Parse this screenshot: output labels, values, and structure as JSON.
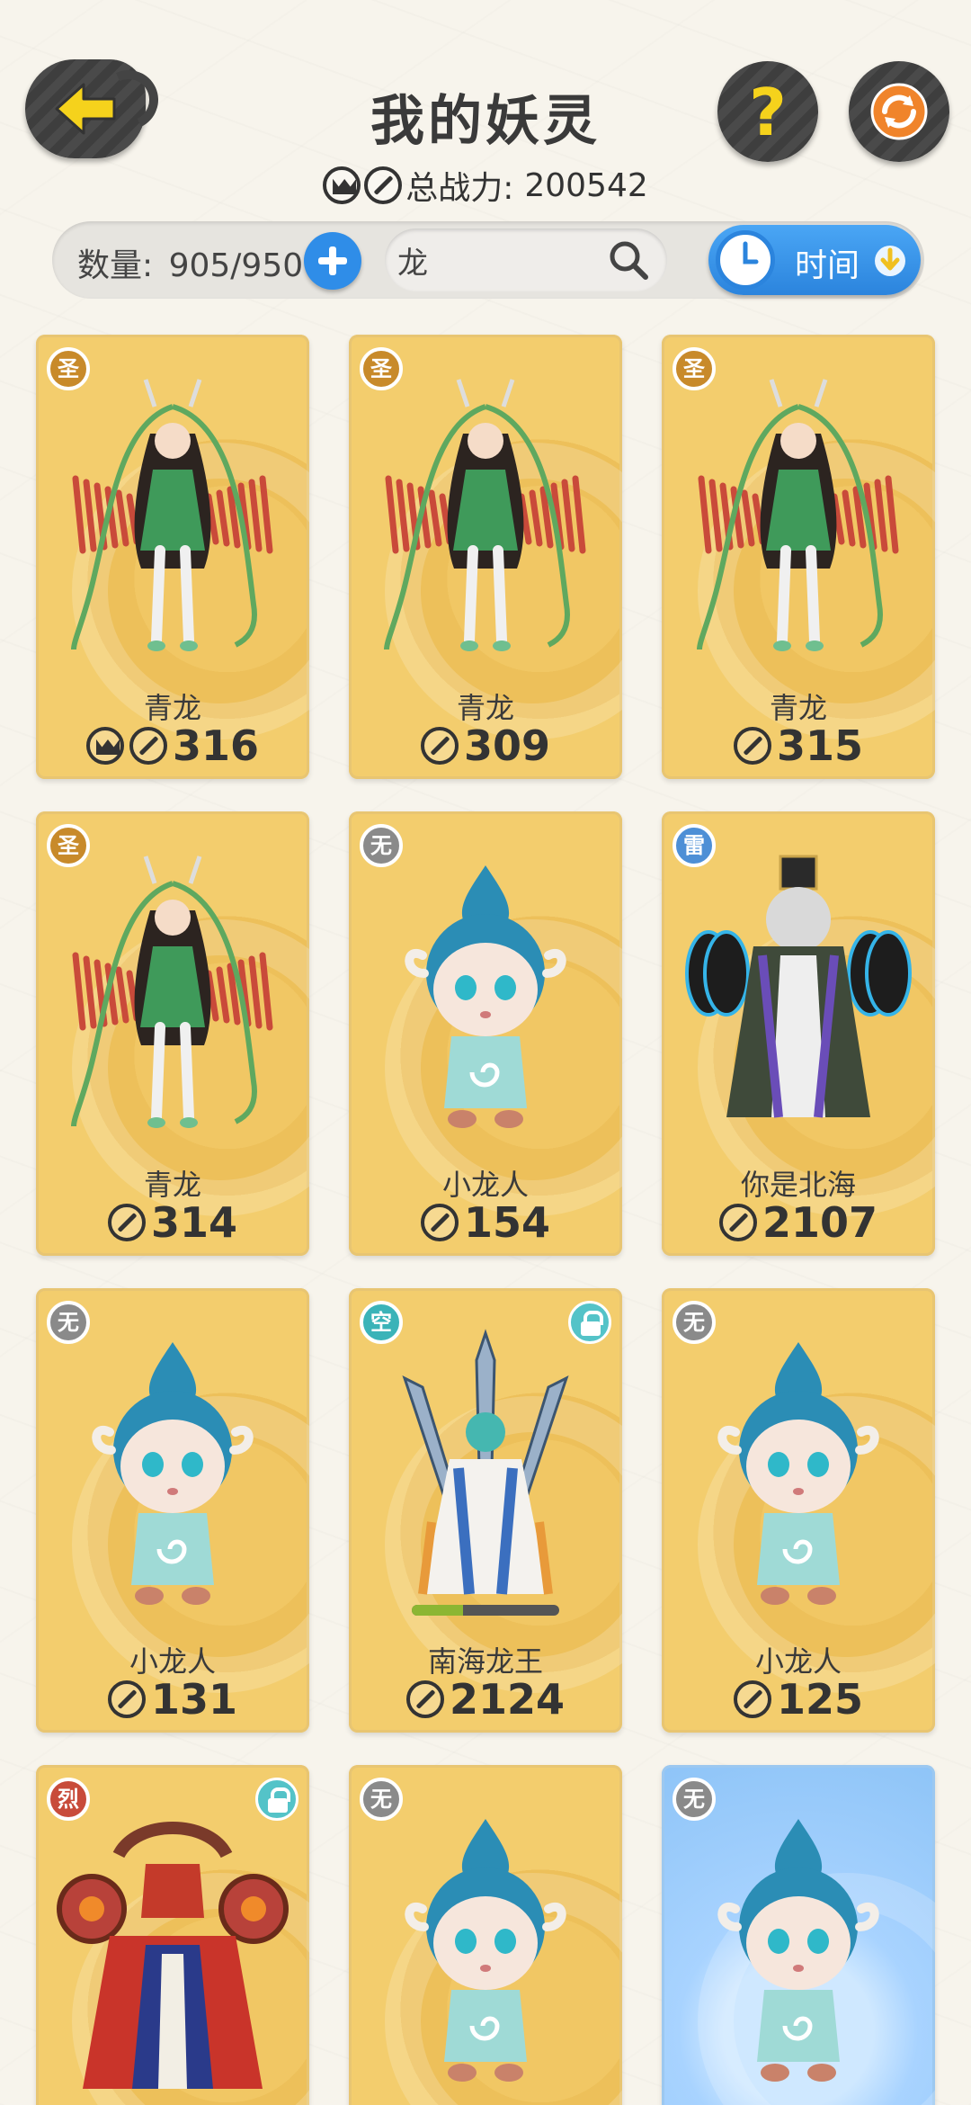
{
  "header": {
    "title": "我的妖灵",
    "power_label": "总战力:",
    "power_value": "200542"
  },
  "toolbar": {
    "count_label": "数量:",
    "count_value": "905/950",
    "search_value": "龙",
    "sort_label": "时间"
  },
  "colors": {
    "card_gold": "#f3cd6d",
    "accent_blue": "#2f8de8",
    "badge_saint": "#c88a2a",
    "badge_none": "#8a8a8a",
    "badge_thunder": "#4d8fd6",
    "badge_void": "#3bb3b8",
    "badge_fire": "#c84b3a"
  },
  "cards": [
    {
      "element": "圣",
      "name": "青龙",
      "power": "316",
      "crown": true,
      "locked": false,
      "figure": "qinglong"
    },
    {
      "element": "圣",
      "name": "青龙",
      "power": "309",
      "crown": false,
      "locked": false,
      "figure": "qinglong"
    },
    {
      "element": "圣",
      "name": "青龙",
      "power": "315",
      "crown": false,
      "locked": false,
      "figure": "qinglong"
    },
    {
      "element": "圣",
      "name": "青龙",
      "power": "314",
      "crown": false,
      "locked": false,
      "figure": "qinglong"
    },
    {
      "element": "无",
      "name": "小龙人",
      "power": "154",
      "crown": false,
      "locked": false,
      "figure": "dragonkid"
    },
    {
      "element": "雷",
      "name": "你是北海",
      "power": "2107",
      "crown": false,
      "locked": false,
      "figure": "beihai"
    },
    {
      "element": "无",
      "name": "小龙人",
      "power": "131",
      "crown": false,
      "locked": false,
      "figure": "dragonkid"
    },
    {
      "element": "空",
      "name": "南海龙王",
      "power": "2124",
      "crown": false,
      "locked": true,
      "figure": "nanhai",
      "progress": 0.35
    },
    {
      "element": "无",
      "name": "小龙人",
      "power": "125",
      "crown": false,
      "locked": false,
      "figure": "dragonkid"
    },
    {
      "element": "烈",
      "name": "",
      "power": "",
      "crown": false,
      "locked": true,
      "figure": "fireking"
    },
    {
      "element": "无",
      "name": "",
      "power": "",
      "crown": false,
      "locked": false,
      "figure": "dragonkid"
    },
    {
      "element": "无",
      "name": "",
      "power": "",
      "crown": false,
      "locked": false,
      "figure": "dragonkid",
      "blue": true
    }
  ]
}
